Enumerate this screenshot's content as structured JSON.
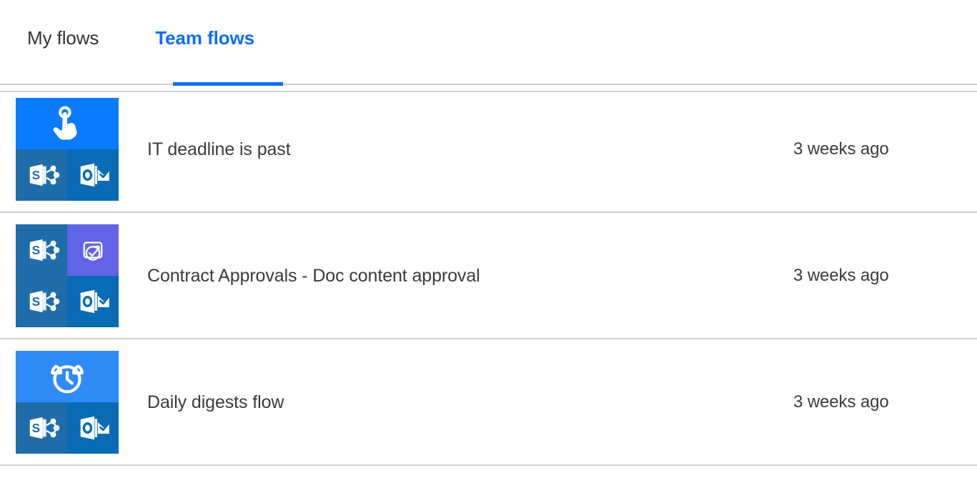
{
  "tabs": [
    {
      "label": "My flows",
      "active": false,
      "name": "tab-my-flows"
    },
    {
      "label": "Team flows",
      "active": true,
      "name": "tab-team-flows"
    }
  ],
  "colors": {
    "accent": "#0f6cf5",
    "tab_inactive_text": "#333333",
    "divider": "#d2d2d2",
    "trigger_button_tile": "#0a7bff",
    "trigger_recurrence_tile": "#2e8af7",
    "sharepoint_tile": "#1f6cab",
    "outlook_tile": "#0a6bb5",
    "approvals_tile": "#6264e8"
  },
  "flows": [
    {
      "title": "IT deadline is past",
      "modified": "3 weeks ago",
      "tiles": [
        {
          "name": "trigger-button-icon",
          "kind": "tap",
          "wide": true,
          "bg": "#0a7bff"
        },
        {
          "name": "sharepoint-icon",
          "kind": "sharepoint",
          "wide": false,
          "bg": "#1f6cab"
        },
        {
          "name": "outlook-icon",
          "kind": "outlook",
          "wide": false,
          "bg": "#0a6bb5"
        }
      ]
    },
    {
      "title": "Contract Approvals - Doc content approval",
      "modified": "3 weeks ago",
      "tiles": [
        {
          "name": "sharepoint-icon",
          "kind": "sharepoint",
          "wide": false,
          "bg": "#1f6cab"
        },
        {
          "name": "approvals-icon",
          "kind": "approvals",
          "wide": false,
          "bg": "#6264e8"
        },
        {
          "name": "sharepoint-icon",
          "kind": "sharepoint",
          "wide": false,
          "bg": "#1f6cab"
        },
        {
          "name": "outlook-icon",
          "kind": "outlook",
          "wide": false,
          "bg": "#0a6bb5"
        }
      ]
    },
    {
      "title": "Daily digests flow",
      "modified": "3 weeks ago",
      "tiles": [
        {
          "name": "trigger-recurrence-icon",
          "kind": "alarm",
          "wide": true,
          "bg": "#2e8af7"
        },
        {
          "name": "sharepoint-icon",
          "kind": "sharepoint",
          "wide": false,
          "bg": "#1f6cab"
        },
        {
          "name": "outlook-icon",
          "kind": "outlook",
          "wide": false,
          "bg": "#0a6bb5"
        }
      ]
    }
  ]
}
